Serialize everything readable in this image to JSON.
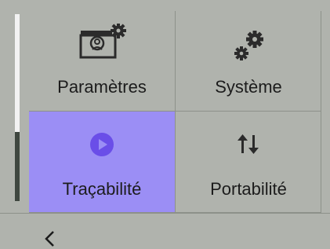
{
  "tiles": [
    {
      "label": "Paramètres",
      "icon": "monitor-gear-icon",
      "selected": false
    },
    {
      "label": "Système",
      "icon": "gears-icon",
      "selected": false
    },
    {
      "label": "Traçabilité",
      "icon": "play-circle-icon",
      "selected": true
    },
    {
      "label": "Portabilité",
      "icon": "up-down-arrows-icon",
      "selected": false
    }
  ],
  "footer": {
    "back_icon": "chevron-left-icon"
  },
  "colors": {
    "background": "#b0b3ad",
    "selected_tile": "#9b8ef5",
    "accent": "#6a4ee8",
    "divider": "#8d918a",
    "scroll_track": "#f2f2f2",
    "scroll_thumb": "#3f4740"
  }
}
